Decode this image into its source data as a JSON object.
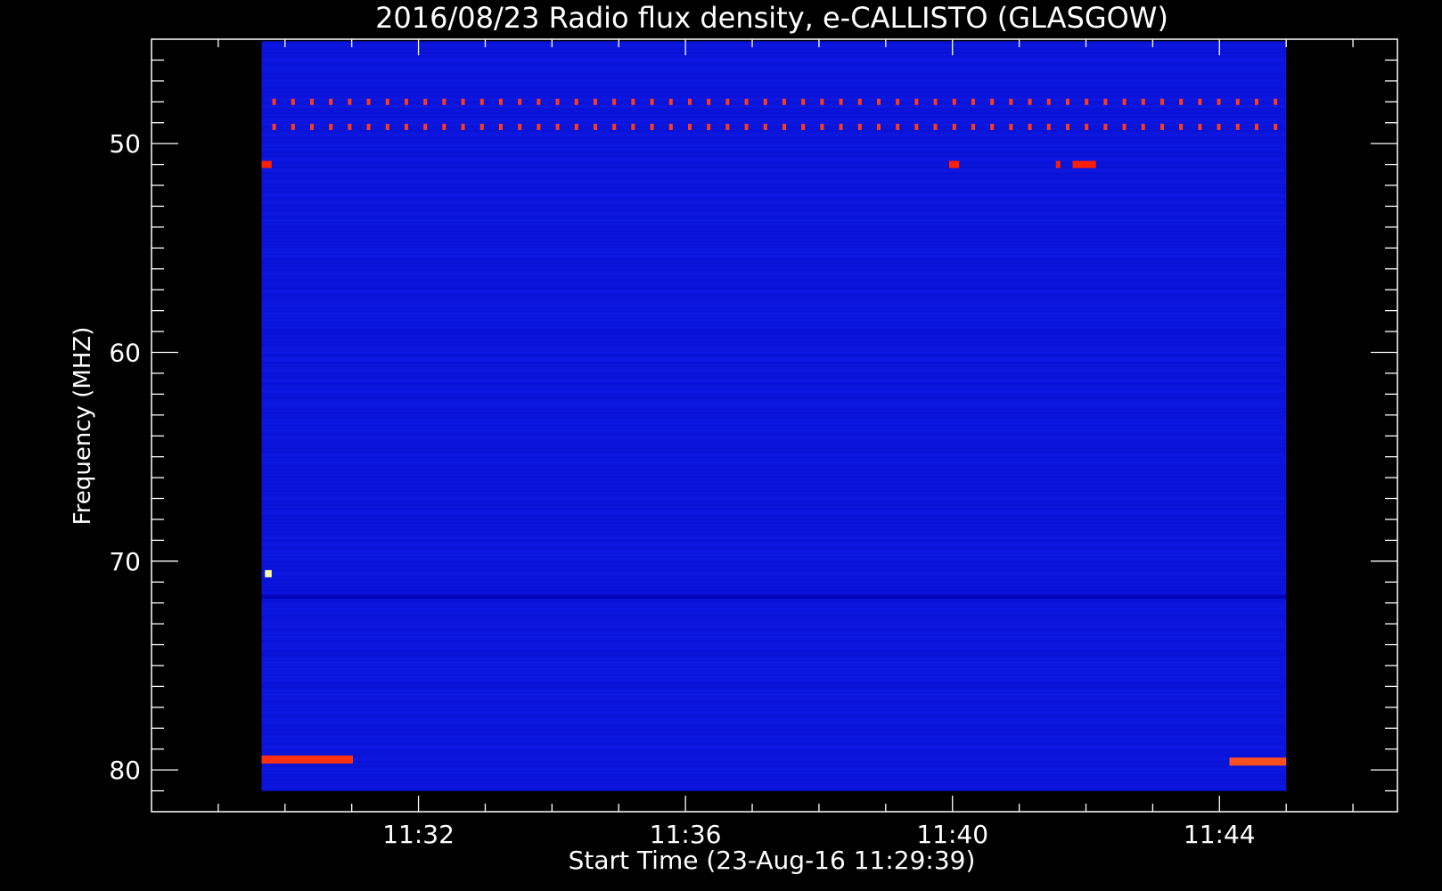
{
  "chart_data": {
    "type": "heatmap",
    "title": "2016/08/23  Radio flux density, e-CALLISTO (GLASGOW)",
    "xlabel": "Start Time (23-Aug-16 11:29:39)",
    "ylabel": "Frequency (MHZ)",
    "x_unit": "time (UTC, HH:MM)",
    "xlim": [
      "11:28:00",
      "11:46:40"
    ],
    "ylim": [
      45,
      82
    ],
    "y_axis_inverted": true,
    "x_ticks": [
      "11:32",
      "11:36",
      "11:40",
      "11:44"
    ],
    "y_ticks": [
      "50",
      "60",
      "70",
      "80"
    ],
    "data_extent": {
      "time_start": "11:29:39",
      "time_end": "11:45:00",
      "freq_min": 45.1,
      "freq_max": 81
    },
    "background_color": "#0a14dc",
    "colormap": [
      "#0000c0",
      "#1a1ae8",
      "#ff1e00",
      "#ffff40",
      "#ffffff"
    ],
    "features": [
      {
        "kind": "periodic-interference",
        "freq": 48,
        "time_start": "11:29:39",
        "time_end": "11:45:00",
        "color": "#ff3a1a"
      },
      {
        "kind": "periodic-interference",
        "freq": 49.2,
        "time_start": "11:29:39",
        "time_end": "11:45:00",
        "color": "#ff3a1a"
      },
      {
        "kind": "burst",
        "freq": 51,
        "time_start": "11:29:39",
        "time_end": "11:29:48",
        "color": "#ff2000"
      },
      {
        "kind": "burst",
        "freq": 51,
        "time_start": "11:39:57",
        "time_end": "11:40:06",
        "color": "#ff2000"
      },
      {
        "kind": "burst",
        "freq": 51,
        "time_start": "11:41:33",
        "time_end": "11:41:37",
        "color": "#ff2000"
      },
      {
        "kind": "burst",
        "freq": 51,
        "time_start": "11:41:48",
        "time_end": "11:42:09",
        "color": "#ff2000"
      },
      {
        "kind": "burst",
        "freq": 70.6,
        "time_start": "11:29:42",
        "time_end": "11:29:48",
        "color": "#ffffa0"
      },
      {
        "kind": "burst",
        "freq": 79.5,
        "time_start": "11:29:39",
        "time_end": "11:31:01",
        "color": "#ff3010"
      },
      {
        "kind": "burst",
        "freq": 79.6,
        "time_start": "11:44:09",
        "time_end": "11:45:00",
        "color": "#ff5020"
      },
      {
        "kind": "dark-band",
        "freq": 71.7,
        "time_start": "11:29:39",
        "time_end": "11:45:00",
        "color": "#0000b0"
      }
    ]
  }
}
